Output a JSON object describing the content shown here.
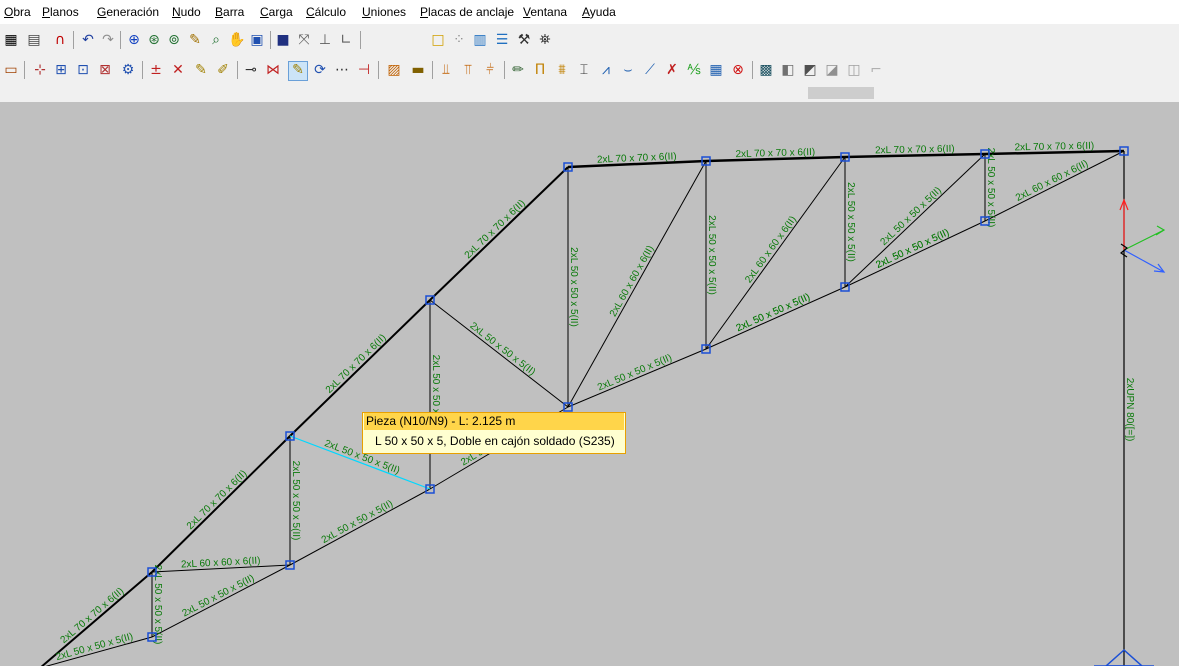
{
  "menu": {
    "items": [
      "Obra",
      "Planos",
      "Generación",
      "Nudo",
      "Barra",
      "Carga",
      "Cálculo",
      "Uniones",
      "Placas de anclaje",
      "Ventana",
      "Ayuda"
    ]
  },
  "toolbar1": {
    "icons": [
      "export-icon",
      "grid-icon",
      "magnet-icon",
      "undo-icon",
      "redo-icon",
      "zoom-window-icon",
      "zoom-all-icon",
      "zoom-icon",
      "select-pencil-icon",
      "search-icon",
      "pan-hand-icon",
      "redraw-icon",
      "view-3d-icon",
      "axis-icon",
      "support-icon",
      "chart-icon",
      "frame-icon",
      "grid-points-icon",
      "layers-icon",
      "list-icon",
      "tools-icon",
      "binoculars-icon"
    ]
  },
  "toolbar2": {
    "icons": [
      "label-icon",
      "new-node-icon",
      "node-frame-icon",
      "node-select-icon",
      "node-delete-icon",
      "node-edit-icon",
      "add-bar-icon",
      "delete-bar-icon",
      "bar-pencil-icon",
      "bar-describe-icon",
      "split-bar-icon",
      "join-bar-icon",
      "edit-bar-icon",
      "rotate-bar-icon",
      "bar-extend-icon",
      "bar-cut-icon",
      "group-icon",
      "layer-icon",
      "coef-icon",
      "buckling-icon",
      "buckling2-icon",
      "pencil-icon",
      "frame-arch-icon",
      "bars-icon",
      "beam-icon",
      "truss-icon",
      "cable-icon",
      "check-icon",
      "cross-check-icon",
      "percent-icon",
      "table-icon",
      "close-red-icon",
      "plate-icon",
      "panel-icon",
      "panel-edit-icon",
      "panel-copy-icon",
      "panel-move-icon",
      "panel-delete-icon"
    ]
  },
  "tooltip": {
    "title": "Pieza (N10/N9) - L: 2.125 m",
    "detail": "L 50 x 50 x 5, Doble en cajón soldado (S235)"
  },
  "colors": {
    "canvas": "#c0c0c0",
    "bar": "#000000",
    "label": "#0a7a0a",
    "node": "#1a4fd6",
    "selected": "#00d8ff",
    "axis_x": "#3060ff",
    "axis_y": "#ff2020",
    "axis_z": "#22c022"
  },
  "model": {
    "bars": [
      {
        "label": "2xL 70 x 70 x 6(II)"
      },
      {
        "label": "2xL 70 x 70 x 6(II)"
      },
      {
        "label": "2xL 70 x 70 x 6(II)"
      },
      {
        "label": "2xL 70 x 70 x 6(II)"
      },
      {
        "label": "2xL 70 x 70 x 6(II)"
      },
      {
        "label": "2xL 70 x 70 x 6(II)"
      },
      {
        "label": "2xL 70 x 70 x 6(II)"
      },
      {
        "label": "2xL 70 x 70 x 6(II)"
      },
      {
        "label": "2xL 70 x 70 x 6(II)"
      },
      {
        "label": "2xL 50 x 50 x 5(II)"
      },
      {
        "label": "2xL 50 x 50 x 5(II)"
      },
      {
        "label": "2xL 50 x 50 x 5(II)"
      },
      {
        "label": "2xL 50 x 50 x 5(II)"
      },
      {
        "label": "2xL 50 x 50 x 5(II)"
      },
      {
        "label": "2xL 50 x 50 x 5(II)"
      },
      {
        "label": "2xL 50 x 50 x 5(II)"
      },
      {
        "label": "2xL 50 x 50 x 5(II)"
      },
      {
        "label": "2xL 50 x 50 x 5(II)"
      },
      {
        "label": "2xL 50 x 50 x 5(II)"
      },
      {
        "label": "2xL 50 x 50 x 5(II)"
      },
      {
        "label": "2xL 50 x 50 x 5(II)"
      },
      {
        "label": "2xL 50 x 50 x 5(II)"
      },
      {
        "label": "2xL 60 x 60 x 6(II)"
      },
      {
        "label": "2xL 50 x 50 x 5(II)"
      },
      {
        "label": "2xL 50 x 50 x 5(II)"
      },
      {
        "label": "2xL 50 x 50 x 5(II)"
      },
      {
        "label": "2xL 50 x 50 x 5(II)"
      },
      {
        "label": "2xL 60 x 60 x 6(II)"
      },
      {
        "label": "2xL 60 x 60 x 6(II)"
      },
      {
        "label": "2xL 50 x 50 x 5(II)"
      },
      {
        "label": "2xL 60 x 60 x 6(II)"
      },
      {
        "label": "2xL 50 x 50 x 5(II)"
      },
      {
        "label": "2xUPN 80([=])"
      }
    ]
  }
}
